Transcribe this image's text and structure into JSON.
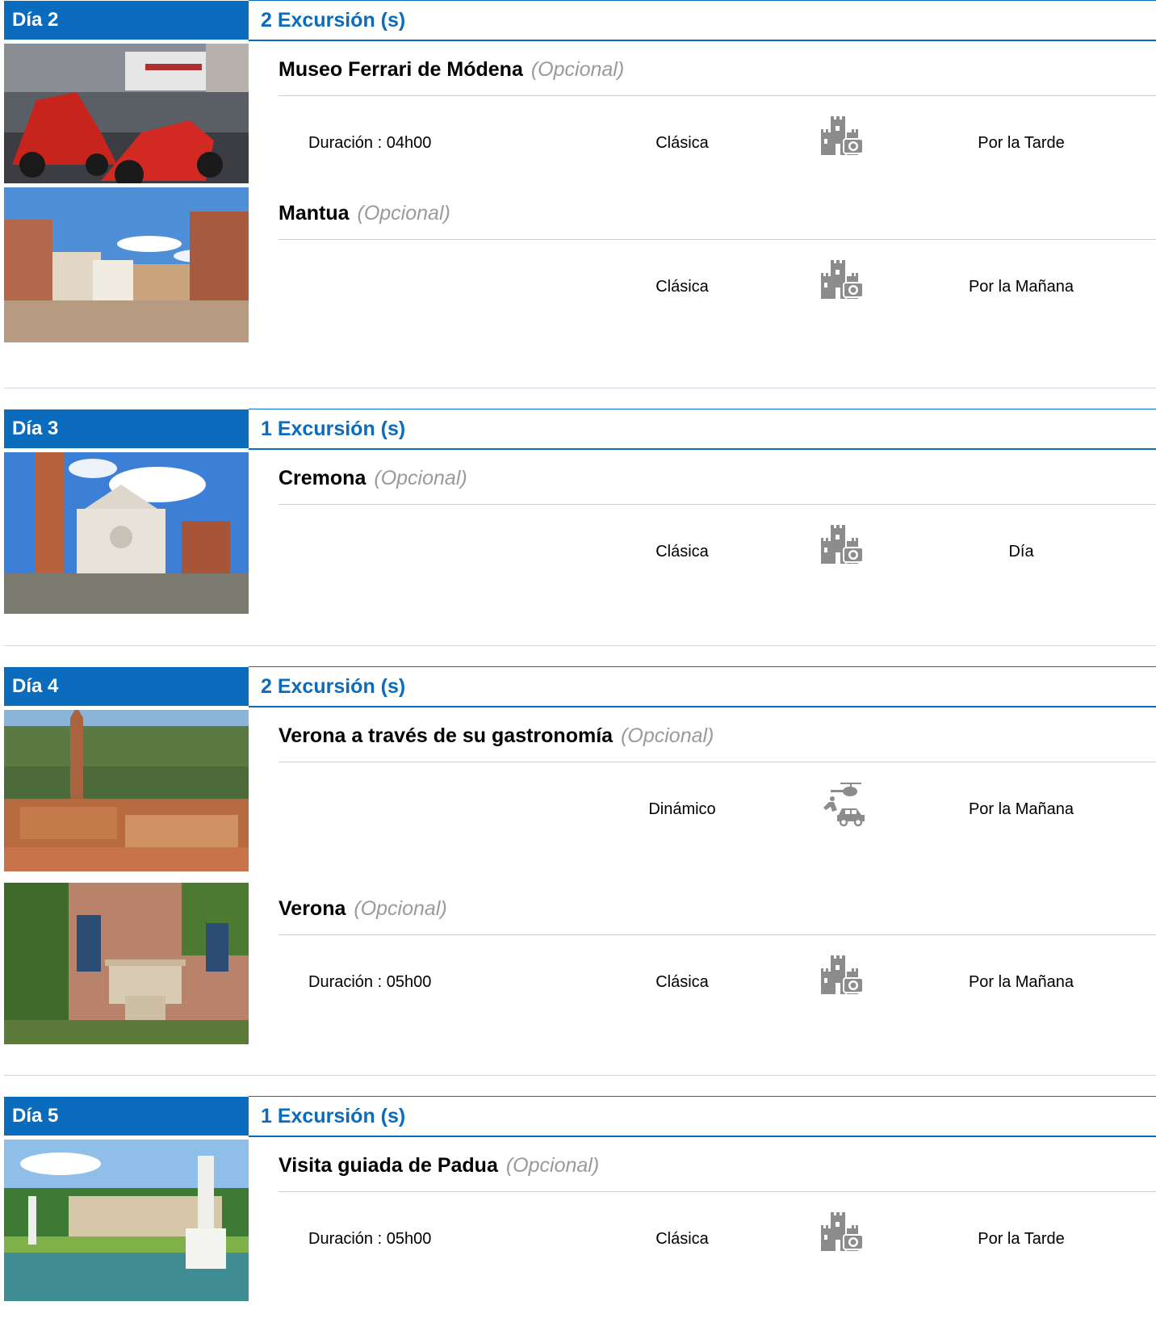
{
  "days": [
    {
      "label": "Día 2",
      "count": "2 Excursión (s)",
      "excursions": [
        {
          "title": "Museo Ferrari de Módena",
          "optional": "(Opcional)",
          "duration": "Duración : 04h00",
          "type": "Clásica",
          "icon": "castle-camera-icon",
          "time": "Por la Tarde"
        },
        {
          "title": "Mantua",
          "optional": "(Opcional)",
          "duration": "",
          "type": "Clásica",
          "icon": "castle-camera-icon",
          "time": "Por la Mañana"
        }
      ]
    },
    {
      "label": "Día 3",
      "count": "1 Excursión (s)",
      "excursions": [
        {
          "title": "Cremona",
          "optional": "(Opcional)",
          "duration": "",
          "type": "Clásica",
          "icon": "castle-camera-icon",
          "time": "Día"
        }
      ]
    },
    {
      "label": "Día 4",
      "count": "2 Excursión (s)",
      "excursions": [
        {
          "title": "Verona a través de su gastronomía",
          "optional": "(Opcional)",
          "duration": "",
          "type": "Dinámico",
          "icon": "helicopter-car-icon",
          "time": "Por la Mañana"
        },
        {
          "title": "Verona",
          "optional": "(Opcional)",
          "duration": "Duración : 05h00",
          "type": "Clásica",
          "icon": "castle-camera-icon",
          "time": "Por la Mañana"
        }
      ]
    },
    {
      "label": "Día 5",
      "count": "1 Excursión (s)",
      "excursions": [
        {
          "title": "Visita guiada de Padua",
          "optional": "(Opcional)",
          "duration": "Duración : 05h00",
          "type": "Clásica",
          "icon": "castle-camera-icon",
          "time": "Por la Tarde"
        }
      ]
    }
  ],
  "colors": {
    "accent": "#0b6bbd",
    "optional_text": "#9a9a9a",
    "icon": "#8c8c8c"
  }
}
